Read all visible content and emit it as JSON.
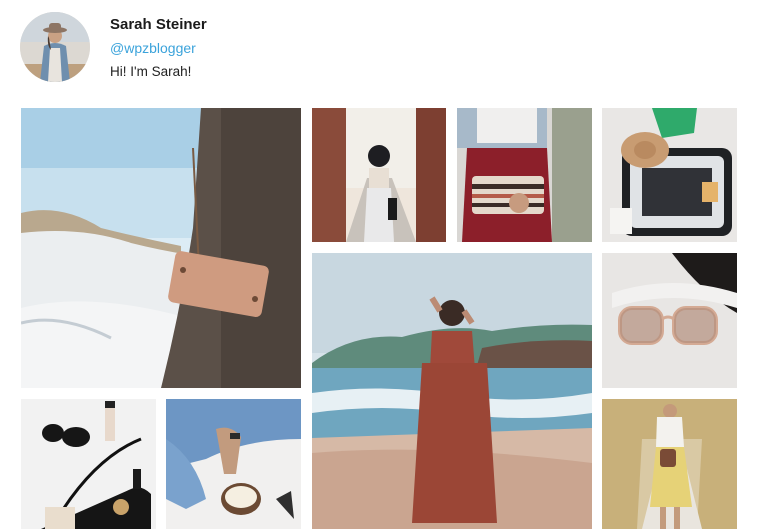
{
  "profile": {
    "name": "Sarah Steiner",
    "handle": "@wpzblogger",
    "bio": "Hi! I'm Sarah!",
    "avatar": "profile-photo-woman-hat"
  },
  "feed": {
    "photos": [
      {
        "subject": "tan crossbody bag on beach dunes"
      },
      {
        "subject": "woman in hat walking in narrow street"
      },
      {
        "subject": "striped clutch with red skirt"
      },
      {
        "subject": "open suitcase flat lay with hat"
      },
      {
        "subject": "woman in rust dress on beach"
      },
      {
        "subject": "rose gold sunglasses"
      },
      {
        "subject": "black accessories flat lay"
      },
      {
        "subject": "jeans and popcorn bowl"
      },
      {
        "subject": "woman in yellow skirt on path"
      }
    ]
  },
  "colors": {
    "handle": "#3ba3db",
    "text": "#1b1b1b",
    "background": "#ffffff"
  }
}
